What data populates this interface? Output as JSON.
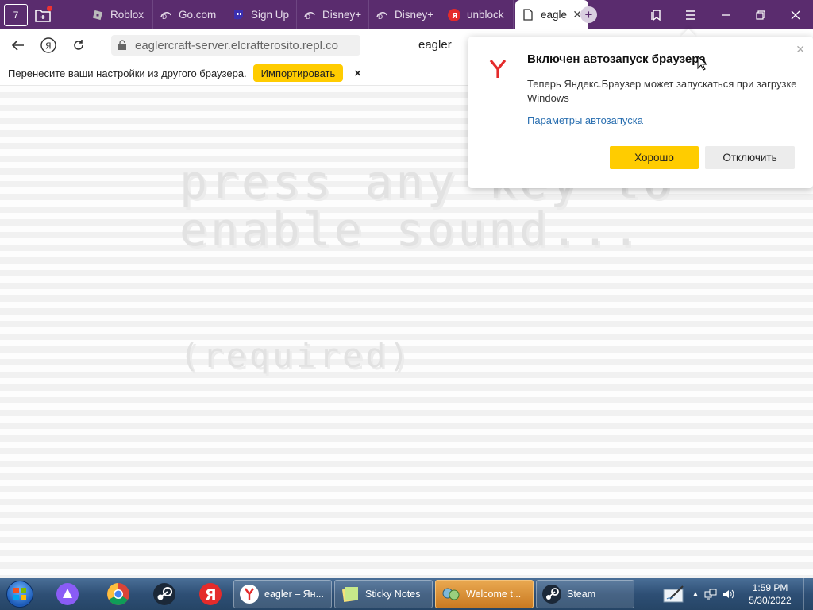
{
  "tabbar": {
    "home_count": "7",
    "tabs": [
      {
        "label": "Roblox",
        "icon": "roblox-icon"
      },
      {
        "label": "Go.com",
        "icon": "disney-icon"
      },
      {
        "label": "Sign Up",
        "icon": "twitch-icon"
      },
      {
        "label": "Disney+",
        "icon": "disney-icon"
      },
      {
        "label": "Disney+",
        "icon": "disney-icon"
      },
      {
        "label": "unblock",
        "icon": "yandex-icon"
      },
      {
        "label": "eagle",
        "icon": "page-icon",
        "active": true
      }
    ],
    "new_tab": "+"
  },
  "addressbar": {
    "url": "eaglercraft-server.elcrafterosito.repl.co",
    "page_title": "eagler"
  },
  "infobar": {
    "message": "Перенесите ваши настройки из другого браузера.",
    "import_label": "Импортировать",
    "close": "×"
  },
  "page": {
    "line1": "press any key to",
    "line2": "enable sound...",
    "line3": "(required)"
  },
  "popup": {
    "title": "Включен автозапуск браузера",
    "body": "Теперь Яндекс.Браузер может запускаться при загрузке Windows",
    "link": "Параметры автозапуска",
    "ok_label": "Хорошо",
    "disable_label": "Отключить"
  },
  "taskbar": {
    "items": [
      {
        "label": "eagler – Ян...",
        "icon": "yandex-browser-icon"
      },
      {
        "label": "Sticky Notes",
        "icon": "sticky-notes-icon"
      },
      {
        "label": "Welcome t...",
        "icon": "welcome-icon",
        "highlighted": true
      },
      {
        "label": "Steam",
        "icon": "steam-icon"
      }
    ],
    "time": "1:59 PM",
    "date": "5/30/2022"
  },
  "colors": {
    "tabbar": "#5a2c6e",
    "accent_yellow": "#ffcc00",
    "link": "#2a6fb0",
    "yandex_red": "#e42b2b"
  }
}
